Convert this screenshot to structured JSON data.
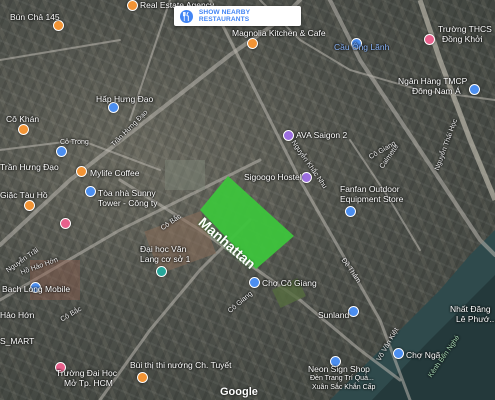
{
  "search_button": {
    "label": "SHOW NEARBY RESTAURANTS",
    "icon": "fork-knife-icon"
  },
  "highlight": {
    "label": "Manhattan",
    "color": "#3dc43c"
  },
  "google_logo": "Google",
  "labels": {
    "bun_cha": "Bún Chả 145",
    "real_estate": "Real Estate Agency",
    "magnolia": "Magnolia Kitchen & Cafe",
    "cau_dong_lanh": "Cầu Ông Lãnh",
    "thcs": "Trường THCS",
    "dong_khoi": "Đồng Khởi",
    "ngan_hang": "Ngân Hàng TMCP",
    "dong_nam_a": "Đông Nam Á",
    "phuong_co_khan": "Cô Khán",
    "co_trong": "Cô Trong",
    "hap_hung_dao": "Hấp Hưng Đạo",
    "ava": "AVA Saigon 2",
    "tran_hung_dao": "Trần Hưng Đạo",
    "giac_tau_ho": "Giặc Tàu Hồ",
    "mylife": "Mylife Coffee",
    "toa_nha": "Tòa nhà Sunny",
    "tower": "Tower - Công ty",
    "sigoogo": "Sigoogo Hostel",
    "fanfan1": "Fanfan Outdoor",
    "fanfan2": "Equipment Store",
    "dai_hoc1": "Đại học Văn",
    "dai_hoc2": "Lang cơ sở 1",
    "bach_long": "Bạch Long Mobile",
    "hao_hon": "Hảo Hớn",
    "cho_co_giang": "Chợ Cô Giang",
    "sunland": "Sunland",
    "s_mart": "S_MART",
    "cho_nga": "Chợ Ngã",
    "nhat_dang1": "Nhất Đăng",
    "nhat_dang2": "Lê Phướ...",
    "bui_thi": "Bùi thị thi nướng Ch. Tuyết",
    "truong_dai_hoc1": "Trường Đại Học",
    "truong_dai_hoc2": "Mở Tp. HCM",
    "neon1": "Neon Sign Shop",
    "neon2": "Đèn Trang Trí Quà...",
    "neon3": "Xuân Sắc Khắn Cấp",
    "r_co_giang": "Cô Giang",
    "r_co_bac": "Cô Bắc",
    "r_co_bac2": "Cô Bắc",
    "r_ho_hao_hon": "Hồ Hảo Hớn",
    "r_vo_van_kiet": "Võ Văn Kiệt",
    "r_ben_nghe": "Kênh Bến Nghé",
    "r_calmette": "Calmette",
    "r_nguyen_thai_hoc": "Nguyễn Thái Học",
    "r_de_tham": "Đề Thám",
    "r_co_giang2": "Cô Giang",
    "r_nguyen_khac_nhu": "Nguyễn Khắc Nhu",
    "r_tran_hung_dao_rd": "Trần Hưng Đạo",
    "r_nguyen_trai": "Nguyễn Trãi"
  }
}
